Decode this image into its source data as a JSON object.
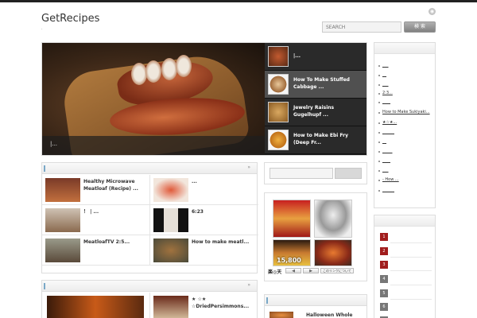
{
  "site": {
    "title": "GetRecipes",
    "subtitle": "."
  },
  "search": {
    "placeholder": "SEARCH",
    "button": "検 索"
  },
  "slider": {
    "hero_caption": "|...",
    "items": [
      {
        "title": "|..."
      },
      {
        "title": "How To Make Stuffed Cabbage ..."
      },
      {
        "title": "Jewelry Raisins Gugelhupf ..."
      },
      {
        "title": "How to Make Ebi Fry (Deep Fr..."
      }
    ]
  },
  "section1": {
    "arrow": "»",
    "posts": [
      {
        "title": "Healthy Microwave Meatloaf (Recipe) ..."
      },
      {
        "title": "..."
      },
      {
        "title": "！ | ..."
      },
      {
        "title": "6:23"
      },
      {
        "title": "MeatloafTV 2:5..."
      },
      {
        "title": "How to make meatl..."
      }
    ]
  },
  "section2": {
    "arrow": "»",
    "posts": [
      {
        "title": "★ ☆★ ☆DriedPersimmons..."
      }
    ]
  },
  "middle": {
    "rakuten_label": "楽◎天",
    "pager_prev": "◀",
    "pager_next": "▶",
    "link_label": "このリンクについて",
    "ad_price": "15,800",
    "bottom_title": "Halloween Whole"
  },
  "right": {
    "links": [
      "___",
      "__",
      "___",
      "2:3...",
      "____",
      "How to Make Sukiyaki...",
      "★☆★...",
      "______",
      "__",
      "_____",
      "____",
      "___",
      "- How ...",
      "______"
    ],
    "ranks": [
      {
        "num": "1",
        "color": "#a11d1d"
      },
      {
        "num": "2",
        "color": "#a11d1d"
      },
      {
        "num": "3",
        "color": "#a11d1d"
      },
      {
        "num": "4",
        "color": "#777777"
      },
      {
        "num": "5",
        "color": "#777777"
      },
      {
        "num": "6",
        "color": "#777777"
      },
      {
        "num": "7",
        "color": "#777777"
      }
    ]
  },
  "colors": {
    "accent": "#7aa8c7",
    "dark": "#2a2a2a"
  }
}
